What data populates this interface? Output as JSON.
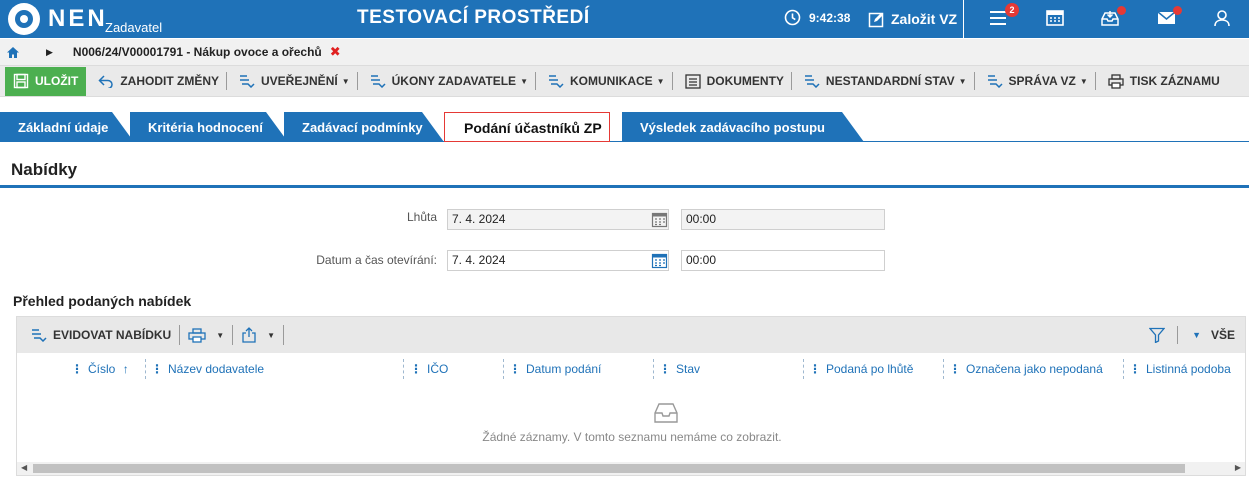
{
  "header": {
    "logo_text": "NEN",
    "logo_sub": "Zadavatel",
    "env_title": "TESTOVACÍ PROSTŘEDÍ",
    "time": "9:42:38",
    "new_vz_label": "Založit VZ",
    "menu_badge": "2",
    "icons": [
      "clock-icon",
      "edit-icon",
      "menu-icon",
      "calendar-icon",
      "inbox-icon",
      "mail-icon",
      "user-icon"
    ]
  },
  "breadcrumb": {
    "title": "N006/24/V00001791 - Nákup ovoce a ořechů",
    "close": "✖"
  },
  "toolbar": {
    "save": "ULOŽIT",
    "discard": "ZAHODIT ZMĚNY",
    "publish": "UVEŘEJNĚNÍ",
    "actions": "ÚKONY ZADAVATELE",
    "communication": "KOMUNIKACE",
    "documents": "DOKUMENTY",
    "nonstandard": "NESTANDARDNÍ STAV",
    "manage": "SPRÁVA VZ",
    "print": "TISK ZÁZNAMU"
  },
  "tabs": {
    "t1": "Základní údaje",
    "t2": "Kritéria hodnocení",
    "t3": "Zadávací podmínky",
    "t4": "Podání účastníků ZP",
    "t5": "Výsledek zadávacího postupu",
    "active": "t4"
  },
  "section": {
    "title": "Nabídky",
    "deadline_label": "Lhůta",
    "deadline_date": "7. 4. 2024",
    "deadline_time": "00:00",
    "open_label": "Datum a čas otevírání:",
    "open_date": "7. 4. 2024",
    "open_time": "00:00"
  },
  "offers": {
    "title": "Přehled podaných nabídek",
    "register_label": "EVIDOVAT NABÍDKU",
    "all_label": "VŠE",
    "columns": {
      "c1": "Číslo",
      "c2": "Název dodavatele",
      "c3": "IČO",
      "c4": "Datum podání",
      "c5": "Stav",
      "c6": "Podaná po lhůtě",
      "c7": "Označena jako nepodaná",
      "c8": "Listinná podoba"
    },
    "sort_icon": "↑",
    "empty_text": "Žádné záznamy. V tomto seznamu nemáme co zobrazit."
  },
  "colors": {
    "brand": "#1f72b8",
    "save": "#4caf50",
    "alert": "#e53935"
  }
}
